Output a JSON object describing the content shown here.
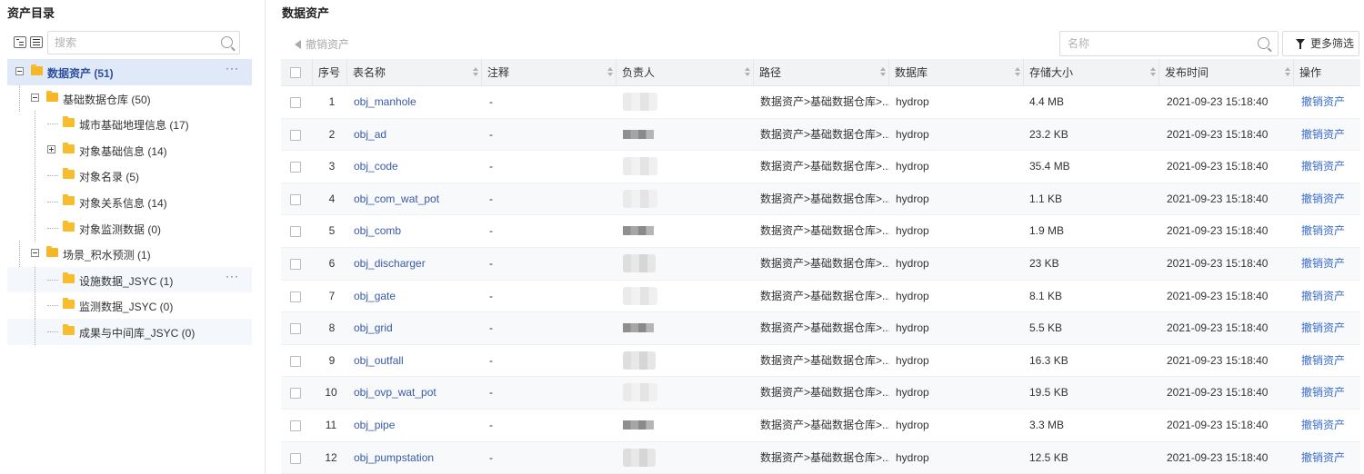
{
  "left": {
    "title": "资产目录",
    "search_placeholder": "搜索",
    "tree": [
      {
        "label": "数据资产 (51)",
        "level": 0,
        "expander": "minus",
        "selected": true,
        "more": "···"
      },
      {
        "label": "基础数据仓库 (50)",
        "level": 1,
        "expander": "minus"
      },
      {
        "label": "城市基础地理信息 (17)",
        "level": 2
      },
      {
        "label": "对象基础信息 (14)",
        "level": 2,
        "expander": "plus"
      },
      {
        "label": "对象名录 (5)",
        "level": 2
      },
      {
        "label": "对象关系信息 (14)",
        "level": 2
      },
      {
        "label": "对象监测数据 (0)",
        "level": 2
      },
      {
        "label": "场景_积水预测 (1)",
        "level": 1,
        "expander": "minus"
      },
      {
        "label": "设施数据_JSYC (1)",
        "level": 2,
        "highlight": true,
        "more": "···"
      },
      {
        "label": "监测数据_JSYC (0)",
        "level": 2
      },
      {
        "label": "成果与中间库_JSYC (0)",
        "level": 2,
        "highlight": true
      }
    ]
  },
  "right": {
    "title": "数据资产",
    "revoke_label": "撤销资产",
    "name_placeholder": "名称",
    "filter_label": "更多筛选"
  },
  "table": {
    "columns": [
      "序号",
      "表名称",
      "注释",
      "负责人",
      "路径",
      "数据库",
      "存储大小",
      "发布时间",
      "操作"
    ],
    "rows": [
      {
        "no": "1",
        "name": "obj_manhole",
        "comment": "-",
        "owner_style": "light",
        "path": "数据资产>基础数据仓库>...",
        "db": "hydrop",
        "size": "4.4 MB",
        "time": "2021-09-23 15:18:40",
        "op": "撤销资产"
      },
      {
        "no": "2",
        "name": "obj_ad",
        "comment": "-",
        "owner_style": "dark",
        "path": "数据资产>基础数据仓库>...",
        "db": "hydrop",
        "size": "23.2 KB",
        "time": "2021-09-23 15:18:40",
        "op": "撤销资产"
      },
      {
        "no": "3",
        "name": "obj_code",
        "comment": "-",
        "owner_style": "light",
        "path": "数据资产>基础数据仓库>...",
        "db": "hydrop",
        "size": "35.4 MB",
        "time": "2021-09-23 15:18:40",
        "op": "撤销资产"
      },
      {
        "no": "4",
        "name": "obj_com_wat_pot",
        "comment": "-",
        "owner_style": "light",
        "path": "数据资产>基础数据仓库>...",
        "db": "hydrop",
        "size": "1.1 KB",
        "time": "2021-09-23 15:18:40",
        "op": "撤销资产"
      },
      {
        "no": "5",
        "name": "obj_comb",
        "comment": "-",
        "owner_style": "dark",
        "path": "数据资产>基础数据仓库>...",
        "db": "hydrop",
        "size": "1.9 MB",
        "time": "2021-09-23 15:18:40",
        "op": "撤销资产"
      },
      {
        "no": "6",
        "name": "obj_discharger",
        "comment": "-",
        "owner_style": "mid",
        "path": "数据资产>基础数据仓库>...",
        "db": "hydrop",
        "size": "23 KB",
        "time": "2021-09-23 15:18:40",
        "op": "撤销资产"
      },
      {
        "no": "7",
        "name": "obj_gate",
        "comment": "-",
        "owner_style": "light",
        "path": "数据资产>基础数据仓库>...",
        "db": "hydrop",
        "size": "8.1 KB",
        "time": "2021-09-23 15:18:40",
        "op": "撤销资产"
      },
      {
        "no": "8",
        "name": "obj_grid",
        "comment": "-",
        "owner_style": "dark",
        "path": "数据资产>基础数据仓库>...",
        "db": "hydrop",
        "size": "5.5 KB",
        "time": "2021-09-23 15:18:40",
        "op": "撤销资产"
      },
      {
        "no": "9",
        "name": "obj_outfall",
        "comment": "-",
        "owner_style": "mid",
        "path": "数据资产>基础数据仓库>...",
        "db": "hydrop",
        "size": "16.3 KB",
        "time": "2021-09-23 15:18:40",
        "op": "撤销资产"
      },
      {
        "no": "10",
        "name": "obj_ovp_wat_pot",
        "comment": "-",
        "owner_style": "light",
        "path": "数据资产>基础数据仓库>...",
        "db": "hydrop",
        "size": "19.5 KB",
        "time": "2021-09-23 15:18:40",
        "op": "撤销资产"
      },
      {
        "no": "11",
        "name": "obj_pipe",
        "comment": "-",
        "owner_style": "dark",
        "path": "数据资产>基础数据仓库>...",
        "db": "hydrop",
        "size": "3.3 MB",
        "time": "2021-09-23 15:18:40",
        "op": "撤销资产"
      },
      {
        "no": "12",
        "name": "obj_pumpstation",
        "comment": "-",
        "owner_style": "mid",
        "path": "数据资产>基础数据仓库>...",
        "db": "hydrop",
        "size": "12.5 KB",
        "time": "2021-09-23 15:18:40",
        "op": "撤销资产"
      }
    ]
  }
}
